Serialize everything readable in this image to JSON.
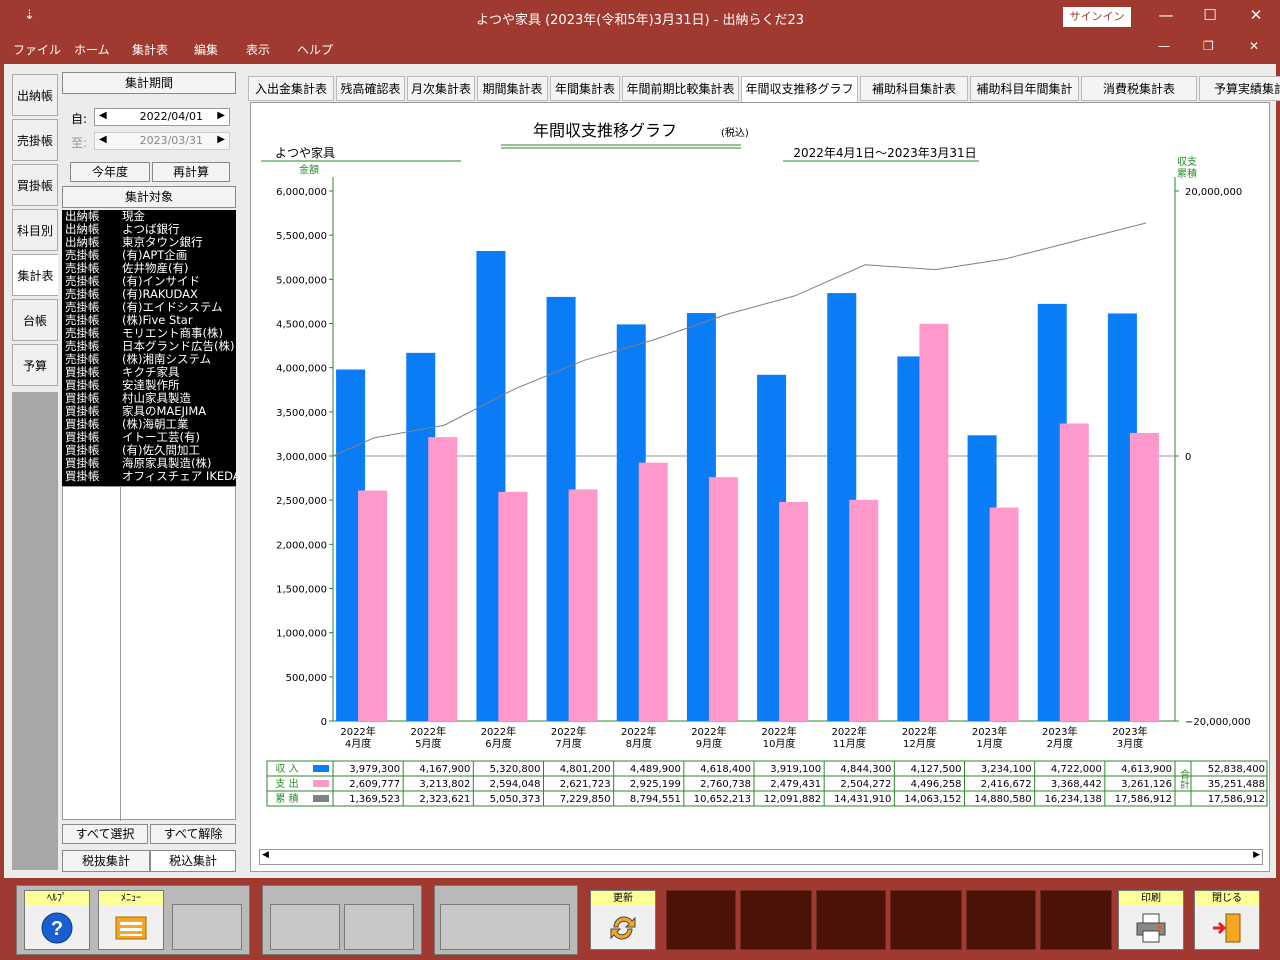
{
  "window": {
    "title": "よつや家具 (2023年(令和5年)3月31日)  -  出納らくだ23",
    "signin": "サインイン",
    "minimize": "—",
    "maximize": "☐",
    "close": "✕",
    "sysmenu": "⇣"
  },
  "menu": {
    "items": [
      "ファイル",
      "ホーム",
      "集計表",
      "編集",
      "表示",
      "ヘルプ"
    ]
  },
  "sidebar": {
    "tabs": [
      "出納帳",
      "売掛帳",
      "買掛帳",
      "科目別",
      "集計表",
      "台帳",
      "予算"
    ]
  },
  "period": {
    "header": "集計期間",
    "from_label": "自:",
    "from_value": "2022/04/01",
    "to_label": "至:",
    "to_value": "2023/03/31",
    "this_year": "今年度",
    "recalc": "再計算"
  },
  "target": {
    "header": "集計対象",
    "rows": [
      [
        "出納帳",
        "現金"
      ],
      [
        "出納帳",
        "よつば銀行"
      ],
      [
        "出納帳",
        "東京タウン銀行"
      ],
      [
        "売掛帳",
        "(有)APT企画"
      ],
      [
        "売掛帳",
        "佐井物産(有)"
      ],
      [
        "売掛帳",
        "(有)インサイド"
      ],
      [
        "売掛帳",
        "(有)RAKUDAX"
      ],
      [
        "売掛帳",
        "(有)エイドシステム"
      ],
      [
        "売掛帳",
        "(株)Five Star"
      ],
      [
        "売掛帳",
        "モリエント商事(株)"
      ],
      [
        "売掛帳",
        "日本グランド広告(株)"
      ],
      [
        "売掛帳",
        "(株)湘南システム"
      ],
      [
        "買掛帳",
        "キクチ家具"
      ],
      [
        "買掛帳",
        "安達製作所"
      ],
      [
        "買掛帳",
        "村山家具製造"
      ],
      [
        "買掛帳",
        "家具のMAEJIMA"
      ],
      [
        "買掛帳",
        "(株)海朝工業"
      ],
      [
        "買掛帳",
        "イトー工芸(有)"
      ],
      [
        "買掛帳",
        "(有)佐久間加工"
      ],
      [
        "買掛帳",
        "海原家具製造(株)"
      ],
      [
        "買掛帳",
        "オフィスチェア IKEDA"
      ]
    ],
    "select_all": "すべて選択",
    "deselect_all": "すべて解除",
    "tax_excl": "税抜集計",
    "tax_incl": "税込集計"
  },
  "report_tabs": [
    "入出金集計表",
    "残高確認表",
    "月次集計表",
    "期間集計表",
    "年間集計表",
    "年間前期比較集計表",
    "年間収支推移グラフ",
    "補助科目集計表",
    "補助科目年間集計表",
    "消費税集計表",
    "予算実績集計表"
  ],
  "chart_data": {
    "type": "bar",
    "title": "年間収支推移グラフ",
    "title_note": "(税込)",
    "company": "よつや家具",
    "period": "2022年4月1日～2023年3月31日",
    "ylabel": "金額",
    "y2label": [
      "収支",
      "累積"
    ],
    "ylim": [
      0,
      6000000
    ],
    "y2lim": [
      -20000000,
      20000000
    ],
    "yticks": [
      "6,000,000",
      "5,500,000",
      "5,000,000",
      "4,500,000",
      "4,000,000",
      "3,500,000",
      "3,000,000",
      "2,500,000",
      "2,000,000",
      "1,500,000",
      "1,000,000",
      "500,000",
      "0"
    ],
    "y2ticks": [
      "20,000,000",
      "0",
      "−20,000,000"
    ],
    "categories": [
      [
        "2022年",
        "4月度"
      ],
      [
        "2022年",
        "5月度"
      ],
      [
        "2022年",
        "6月度"
      ],
      [
        "2022年",
        "7月度"
      ],
      [
        "2022年",
        "8月度"
      ],
      [
        "2022年",
        "9月度"
      ],
      [
        "2022年",
        "10月度"
      ],
      [
        "2022年",
        "11月度"
      ],
      [
        "2022年",
        "12月度"
      ],
      [
        "2023年",
        "1月度"
      ],
      [
        "2023年",
        "2月度"
      ],
      [
        "2023年",
        "3月度"
      ]
    ],
    "series": [
      {
        "name": "収 入",
        "color": "#0a7cf5",
        "values": [
          3979300,
          4167900,
          5320800,
          4801200,
          4489900,
          4618400,
          3919100,
          4844300,
          4127500,
          3234100,
          4722000,
          4613900
        ],
        "labels": [
          "3,979,300",
          "4,167,900",
          "5,320,800",
          "4,801,200",
          "4,489,900",
          "4,618,400",
          "3,919,100",
          "4,844,300",
          "4,127,500",
          "3,234,100",
          "4,722,000",
          "4,613,900"
        ],
        "total": "52,838,400"
      },
      {
        "name": "支 出",
        "color": "#ff99cc",
        "values": [
          2609777,
          3213802,
          2594048,
          2621723,
          2925199,
          2760738,
          2479431,
          2504272,
          4496258,
          2416672,
          3368442,
          3261126
        ],
        "labels": [
          "2,609,777",
          "3,213,802",
          "2,594,048",
          "2,621,723",
          "2,925,199",
          "2,760,738",
          "2,479,431",
          "2,504,272",
          "4,496,258",
          "2,416,672",
          "3,368,442",
          "3,261,126"
        ],
        "total": "35,251,488"
      },
      {
        "name": "累 積",
        "color": "#808080",
        "values": [
          1369523,
          2323621,
          5050373,
          7229850,
          8794551,
          10652213,
          12091882,
          14431910,
          14063152,
          14880580,
          16234138,
          17586912
        ],
        "labels": [
          "1,369,523",
          "2,323,621",
          "5,050,373",
          "7,229,850",
          "8,794,551",
          "10,652,213",
          "12,091,882",
          "14,431,910",
          "14,063,152",
          "14,880,580",
          "16,234,138",
          "17,586,912"
        ],
        "total": "17,586,912"
      }
    ],
    "total_label": "合計"
  },
  "bottom": {
    "help": "ﾍﾙﾌﾟ",
    "menu": "ﾒﾆｭｰ",
    "refresh": "更新",
    "print": "印刷",
    "close": "閉じる"
  }
}
